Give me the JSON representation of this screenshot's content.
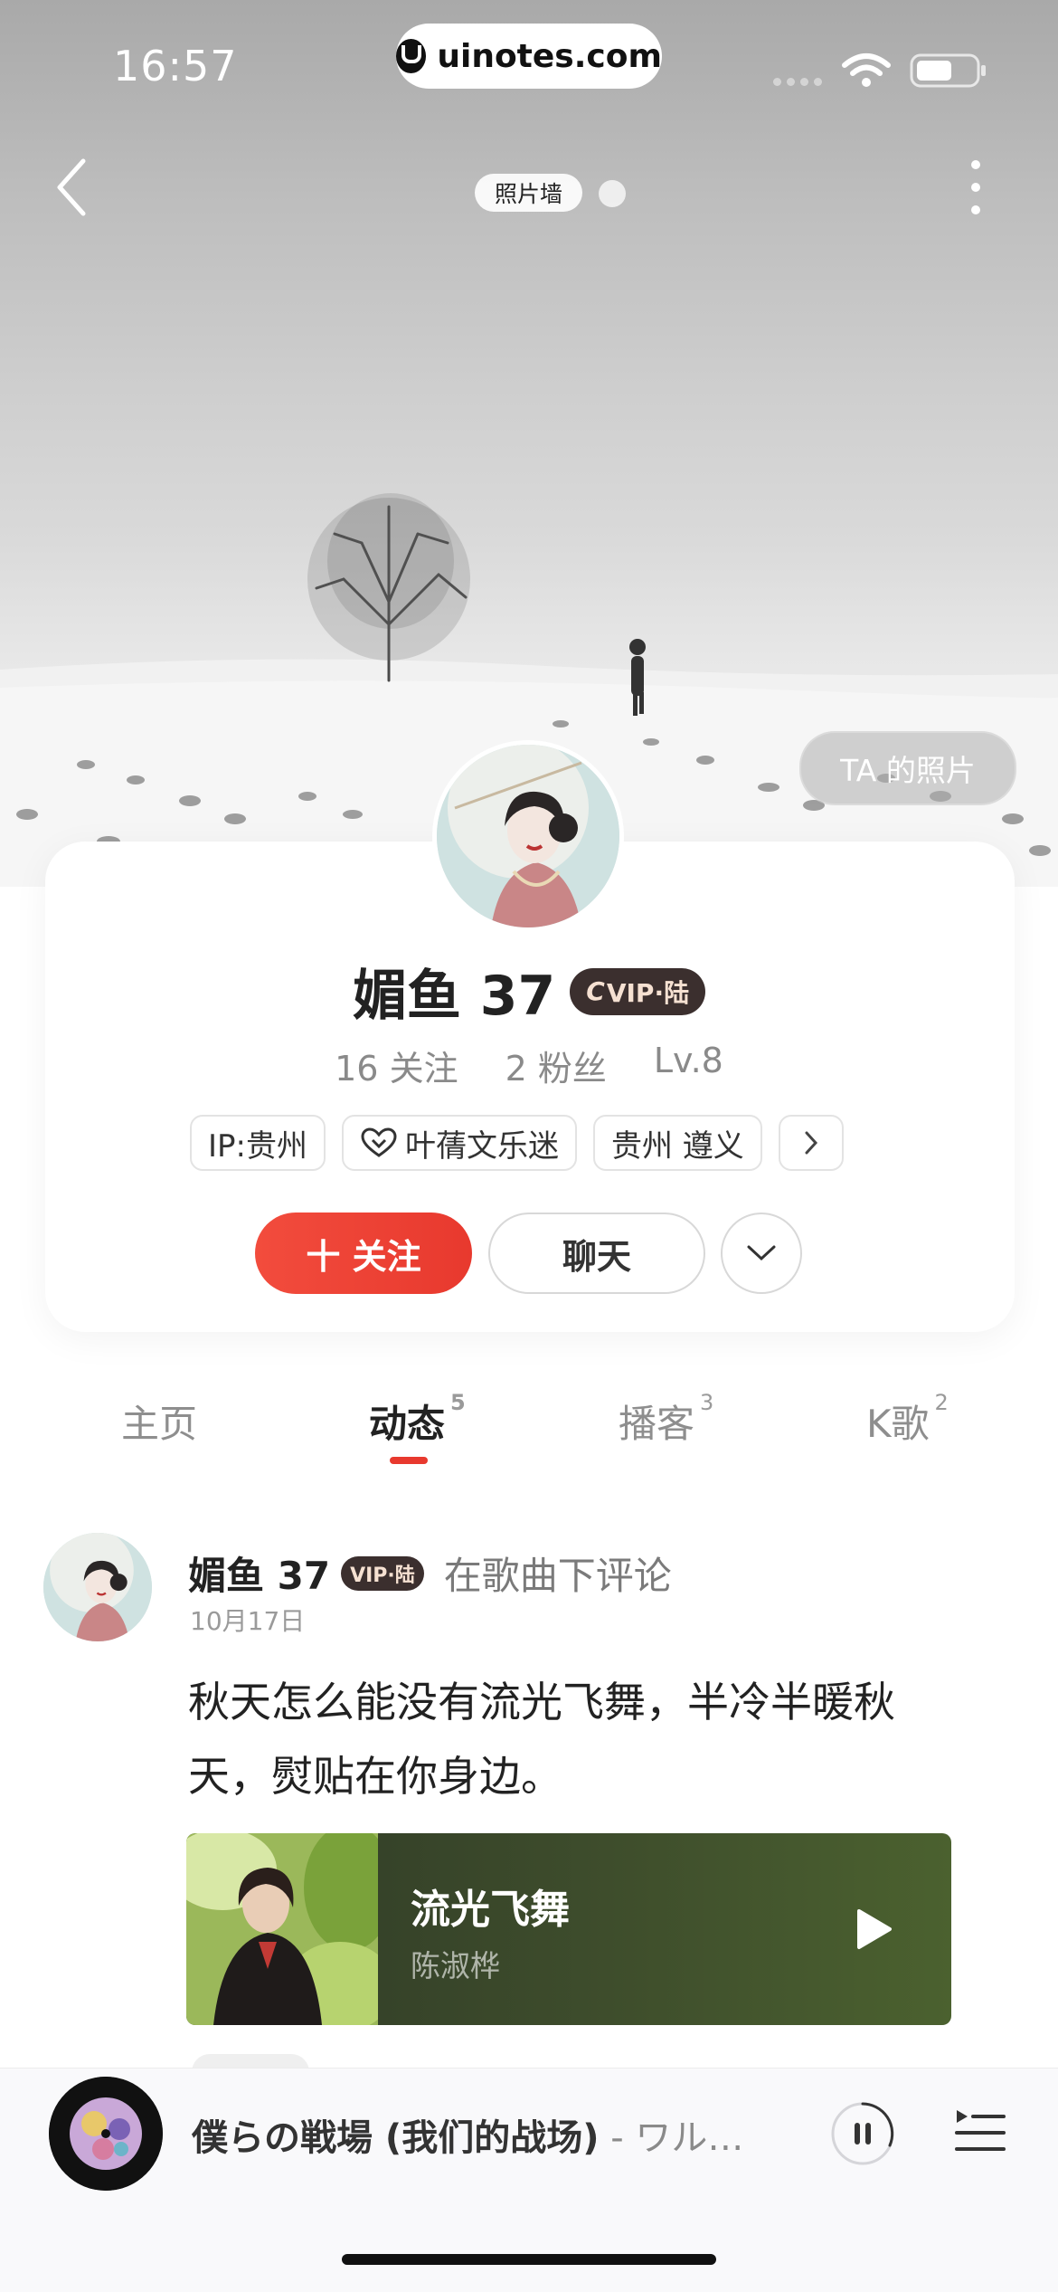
{
  "status_bar": {
    "time": "16:57",
    "url": "uinotes.com"
  },
  "hero": {
    "photowall_label": "照片墙",
    "ta_photos_label": "TA 的照片"
  },
  "profile": {
    "nickname": "媚鱼 37",
    "vip": "VIP·陆",
    "vip_logo": "C",
    "following_count": "16",
    "following_label": "关注",
    "followers_count": "2",
    "followers_label": "粉丝",
    "level": "Lv.8",
    "tags": [
      "IP:贵州",
      "叶蒨文乐迷",
      "贵州 遵义"
    ],
    "follow_label": "十 关注",
    "chat_label": "聊天"
  },
  "tabs": [
    {
      "label": "主页",
      "count": ""
    },
    {
      "label": "动态",
      "count": "5"
    },
    {
      "label": "播客",
      "count": "3"
    },
    {
      "label": "K歌",
      "count": "2"
    }
  ],
  "post": {
    "author": "媚鱼 37",
    "vip": "VIP·陆",
    "action": "在歌曲下评论",
    "date": "10月17日",
    "text": "秋天怎么能没有流光飞舞，半冷半暖秋天，熨贴在你身边。",
    "song": {
      "title": "流光飞舞",
      "artist": "陈淑桦"
    }
  },
  "player": {
    "title": "僕らの戦場 (我们的战场)",
    "subtitle": " - ワル…"
  },
  "colors": {
    "accent": "#e8392e",
    "vip_bg": "#3b2f2e"
  }
}
